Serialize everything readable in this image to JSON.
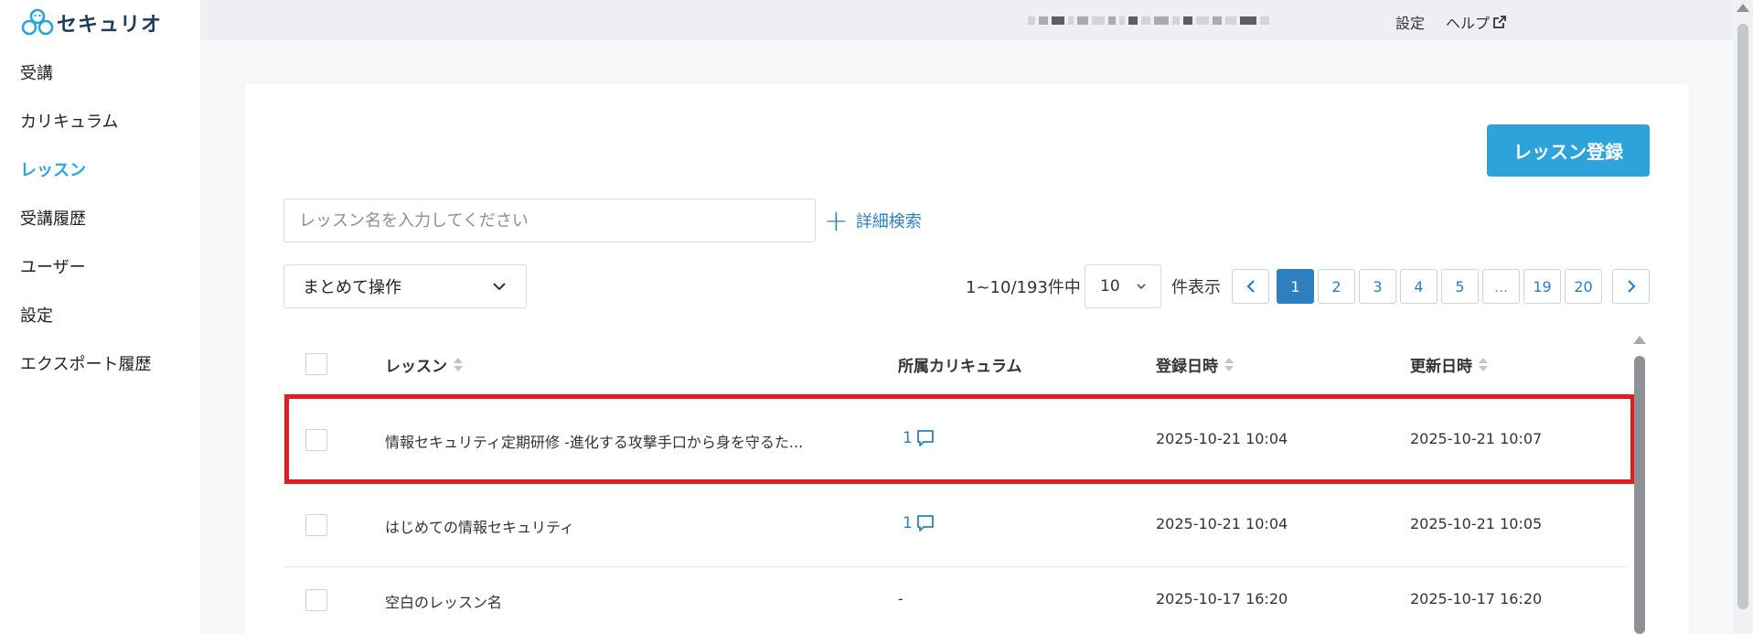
{
  "brand": {
    "name": "セキュリオ"
  },
  "sidebar": {
    "items": [
      {
        "label": "受講"
      },
      {
        "label": "カリキュラム"
      },
      {
        "label": "レッスン",
        "active": true
      },
      {
        "label": "受講履歴"
      },
      {
        "label": "ユーザー"
      },
      {
        "label": "設定"
      },
      {
        "label": "エクスポート履歴"
      }
    ]
  },
  "header": {
    "settings": "設定",
    "help": "ヘルプ"
  },
  "toolbar": {
    "register_button": "レッスン登録",
    "search_placeholder": "レッスン名を入力してください",
    "advanced_search": "詳細検索",
    "bulk_action": "まとめて操作"
  },
  "pagination": {
    "summary": "1~10/193件中",
    "per_page": "10",
    "per_page_suffix": "件表示",
    "pages": [
      "1",
      "2",
      "3",
      "4",
      "5",
      "...",
      "19",
      "20"
    ],
    "current": "1"
  },
  "table": {
    "headers": {
      "lesson": "レッスン",
      "curriculum": "所属カリキュラム",
      "created": "登録日時",
      "updated": "更新日時"
    },
    "rows": [
      {
        "name": "情報セキュリティ定期研修 -進化する攻撃手口から身を守るた...",
        "curriculum": "1",
        "created": "2025-10-21 10:04",
        "updated": "2025-10-21 10:07",
        "highlighted": true
      },
      {
        "name": "はじめての情報セキュリティ",
        "curriculum": "1",
        "created": "2025-10-21 10:04",
        "updated": "2025-10-21 10:05"
      },
      {
        "name": "空白のレッスン名",
        "curriculum": "-",
        "created": "2025-10-17 16:20",
        "updated": "2025-10-17 16:20"
      }
    ]
  },
  "colors": {
    "accent": "#2ea2db",
    "link": "#2e7fc0",
    "highlight": "#e11c24"
  }
}
